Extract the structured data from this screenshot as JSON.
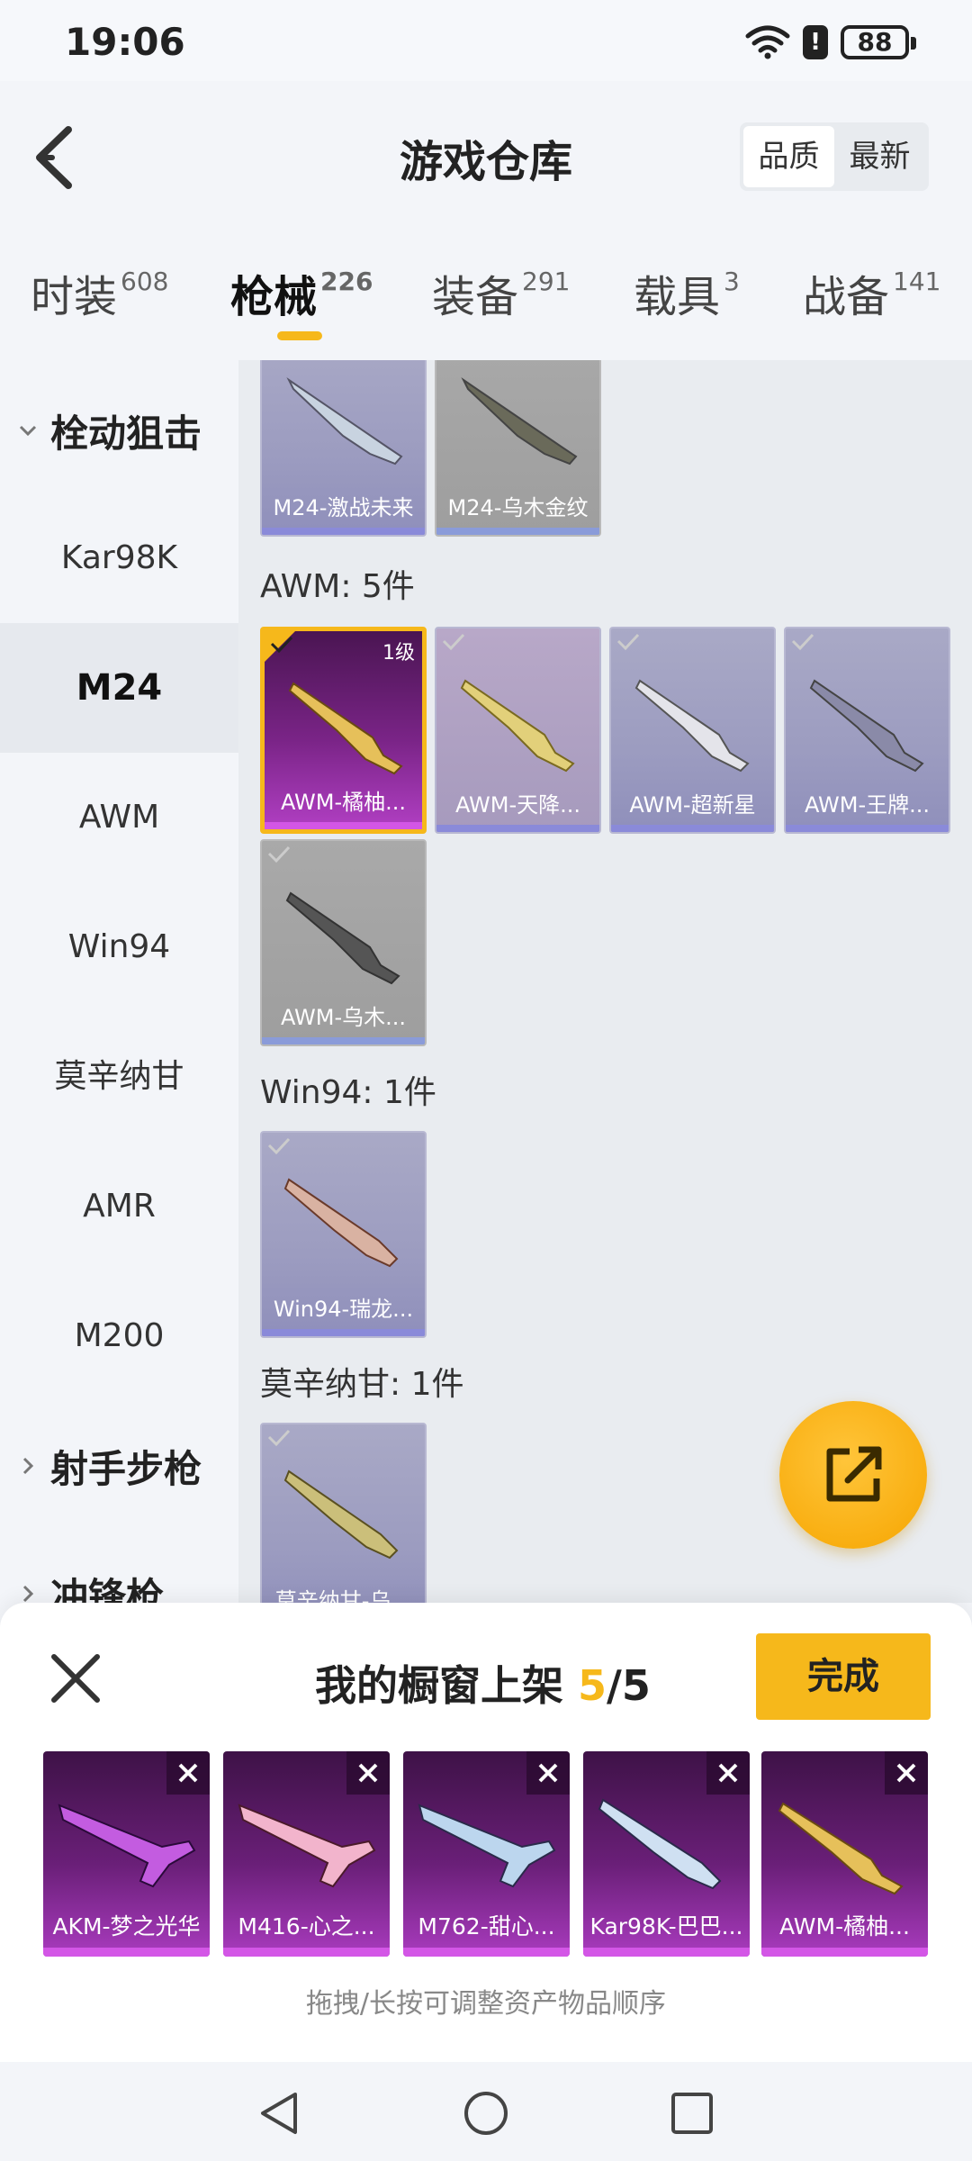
{
  "status_bar": {
    "time": "19:06",
    "battery": "88"
  },
  "header": {
    "title": "游戏仓库",
    "sort_options": [
      "品质",
      "最新"
    ]
  },
  "tabs": [
    {
      "label": "时装",
      "count": "608"
    },
    {
      "label": "枪械",
      "count": "226"
    },
    {
      "label": "装备",
      "count": "291"
    },
    {
      "label": "载具",
      "count": "3"
    },
    {
      "label": "战备",
      "count": "141"
    }
  ],
  "sidebar": {
    "group1": "栓动狙击",
    "items": [
      "Kar98K",
      "M24",
      "AWM",
      "Win94",
      "莫辛纳甘",
      "AMR",
      "M200"
    ],
    "group2": "射手步枪",
    "group3": "冲锋枪"
  },
  "content": {
    "m24_items": [
      "M24-激战未来",
      "M24-乌木金纹"
    ],
    "awm_title": "AWM: 5件",
    "awm_items": [
      "AWM-橘柚...",
      "AWM-天降...",
      "AWM-超新星",
      "AWM-王牌...",
      "AWM-乌木..."
    ],
    "awm_level": "1级",
    "win94_title": "Win94: 1件",
    "win94_items": [
      "Win94-瑞龙..."
    ],
    "mosin_title": "莫辛纳甘: 1件",
    "mosin_items": [
      "莫辛纳甘-乌..."
    ]
  },
  "sheet": {
    "title_prefix": "我的橱窗上架 ",
    "count_current": "5",
    "count_total": "/5",
    "done_label": "完成",
    "shelf_items": [
      "AKM-梦之光华",
      "M416-心之...",
      "M762-甜心...",
      "Kar98K-巴巴...",
      "AWM-橘柚..."
    ],
    "hint": "拖拽/长按可调整资产物品顺序"
  },
  "colors": {
    "accent": "#f6b81b",
    "selected_card": "#7a2487"
  }
}
